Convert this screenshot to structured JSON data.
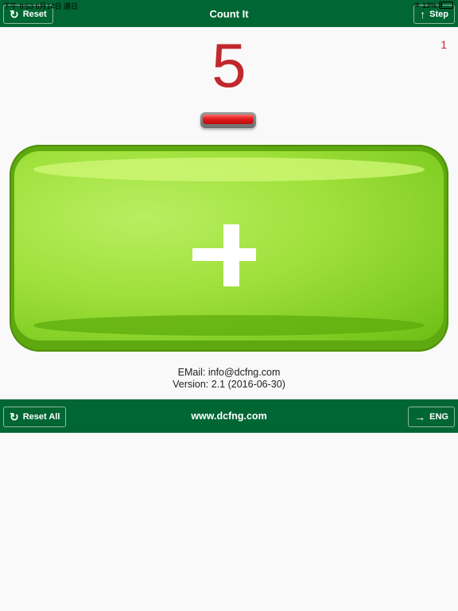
{
  "status": {
    "time_date": "下午 8:53   6月14日 週日",
    "battery": "13%"
  },
  "header": {
    "title": "Count It",
    "reset_label": "Reset",
    "step_label": "Step"
  },
  "counter": {
    "step": "1",
    "count": "5"
  },
  "info": {
    "email": "EMail: info@dcfng.com",
    "version": "Version: 2.1 (2016-06-30)"
  },
  "footer": {
    "reset_all_label": "Reset All",
    "website": "www.dcfng.com",
    "language_label": "ENG"
  },
  "icons": {
    "reset": "refresh-icon",
    "step": "arrow-up-icon",
    "language": "arrow-right-icon"
  },
  "colors": {
    "bar": "#006633",
    "count": "#c1272d",
    "plus": "#8fd62a",
    "minus": "#e51b1b"
  }
}
